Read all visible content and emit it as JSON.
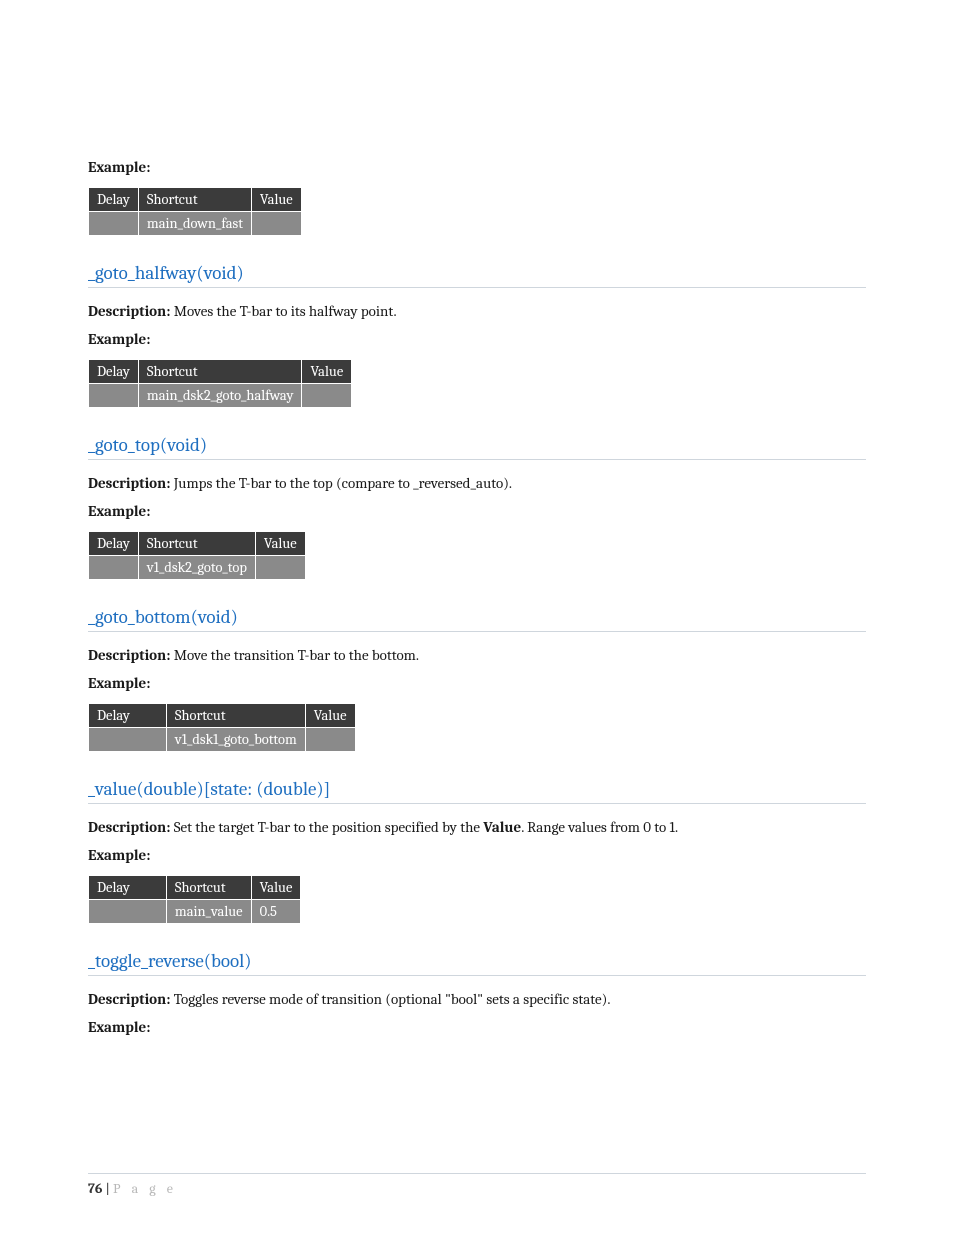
{
  "labels": {
    "example": "Example:",
    "description": "Description:",
    "col_delay": "Delay",
    "col_shortcut": "Shortcut",
    "col_value": "Value"
  },
  "sections": [
    {
      "heading": null,
      "description": null,
      "example_label": "Example:",
      "table": {
        "delay_col_extra_pad": false,
        "rows": [
          {
            "delay": "",
            "shortcut": "main_down_fast",
            "value": ""
          }
        ]
      }
    },
    {
      "heading": "_goto_halfway(void)",
      "description": "Moves the T-bar to its halfway point.",
      "example_label": "Example:",
      "table": {
        "delay_col_extra_pad": false,
        "rows": [
          {
            "delay": "",
            "shortcut": "main_dsk2_goto_halfway",
            "value": ""
          }
        ]
      }
    },
    {
      "heading": "_goto_top(void)",
      "description": "Jumps the T-bar to the top (compare to _reversed_auto).",
      "example_label": "Example:",
      "table": {
        "delay_col_extra_pad": false,
        "rows": [
          {
            "delay": "",
            "shortcut": "v1_dsk2_goto_top",
            "value": ""
          }
        ]
      }
    },
    {
      "heading": "_goto_bottom(void)",
      "description": "Move the transition T-bar to the bottom.",
      "example_label": "Example:",
      "table": {
        "delay_col_extra_pad": true,
        "rows": [
          {
            "delay": "",
            "shortcut": "v1_dsk1_goto_bottom",
            "value": ""
          }
        ]
      }
    },
    {
      "heading": "_value(double)[state: (double)]",
      "description_parts": [
        "Set the target T-bar to the position specified by the ",
        "Value",
        ". Range values from 0 to 1."
      ],
      "example_label": "Example:",
      "table": {
        "delay_col_extra_pad": true,
        "rows": [
          {
            "delay": "",
            "shortcut": "main_value",
            "value": "0.5"
          }
        ]
      }
    },
    {
      "heading": "_toggle_reverse(bool)",
      "description": "Toggles reverse mode of transition (optional \"bool\" sets a specific state).",
      "example_label": "Example:",
      "table": null
    }
  ],
  "footer": {
    "page_number": "76",
    "page_word": "P a g e"
  }
}
